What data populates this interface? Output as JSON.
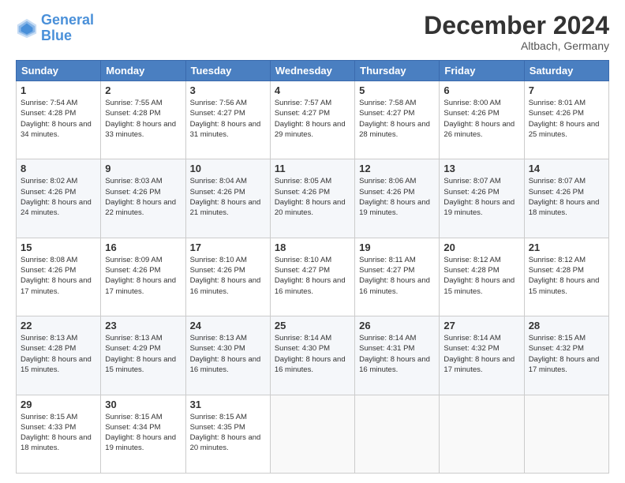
{
  "logo": {
    "line1": "General",
    "line2": "Blue"
  },
  "title": "December 2024",
  "location": "Altbach, Germany",
  "days_header": [
    "Sunday",
    "Monday",
    "Tuesday",
    "Wednesday",
    "Thursday",
    "Friday",
    "Saturday"
  ],
  "weeks": [
    [
      {
        "num": "1",
        "rise": "7:54 AM",
        "set": "4:28 PM",
        "daylight": "8 hours and 34 minutes."
      },
      {
        "num": "2",
        "rise": "7:55 AM",
        "set": "4:28 PM",
        "daylight": "8 hours and 33 minutes."
      },
      {
        "num": "3",
        "rise": "7:56 AM",
        "set": "4:27 PM",
        "daylight": "8 hours and 31 minutes."
      },
      {
        "num": "4",
        "rise": "7:57 AM",
        "set": "4:27 PM",
        "daylight": "8 hours and 29 minutes."
      },
      {
        "num": "5",
        "rise": "7:58 AM",
        "set": "4:27 PM",
        "daylight": "8 hours and 28 minutes."
      },
      {
        "num": "6",
        "rise": "8:00 AM",
        "set": "4:26 PM",
        "daylight": "8 hours and 26 minutes."
      },
      {
        "num": "7",
        "rise": "8:01 AM",
        "set": "4:26 PM",
        "daylight": "8 hours and 25 minutes."
      }
    ],
    [
      {
        "num": "8",
        "rise": "8:02 AM",
        "set": "4:26 PM",
        "daylight": "8 hours and 24 minutes."
      },
      {
        "num": "9",
        "rise": "8:03 AM",
        "set": "4:26 PM",
        "daylight": "8 hours and 22 minutes."
      },
      {
        "num": "10",
        "rise": "8:04 AM",
        "set": "4:26 PM",
        "daylight": "8 hours and 21 minutes."
      },
      {
        "num": "11",
        "rise": "8:05 AM",
        "set": "4:26 PM",
        "daylight": "8 hours and 20 minutes."
      },
      {
        "num": "12",
        "rise": "8:06 AM",
        "set": "4:26 PM",
        "daylight": "8 hours and 19 minutes."
      },
      {
        "num": "13",
        "rise": "8:07 AM",
        "set": "4:26 PM",
        "daylight": "8 hours and 19 minutes."
      },
      {
        "num": "14",
        "rise": "8:07 AM",
        "set": "4:26 PM",
        "daylight": "8 hours and 18 minutes."
      }
    ],
    [
      {
        "num": "15",
        "rise": "8:08 AM",
        "set": "4:26 PM",
        "daylight": "8 hours and 17 minutes."
      },
      {
        "num": "16",
        "rise": "8:09 AM",
        "set": "4:26 PM",
        "daylight": "8 hours and 17 minutes."
      },
      {
        "num": "17",
        "rise": "8:10 AM",
        "set": "4:26 PM",
        "daylight": "8 hours and 16 minutes."
      },
      {
        "num": "18",
        "rise": "8:10 AM",
        "set": "4:27 PM",
        "daylight": "8 hours and 16 minutes."
      },
      {
        "num": "19",
        "rise": "8:11 AM",
        "set": "4:27 PM",
        "daylight": "8 hours and 16 minutes."
      },
      {
        "num": "20",
        "rise": "8:12 AM",
        "set": "4:28 PM",
        "daylight": "8 hours and 15 minutes."
      },
      {
        "num": "21",
        "rise": "8:12 AM",
        "set": "4:28 PM",
        "daylight": "8 hours and 15 minutes."
      }
    ],
    [
      {
        "num": "22",
        "rise": "8:13 AM",
        "set": "4:28 PM",
        "daylight": "8 hours and 15 minutes."
      },
      {
        "num": "23",
        "rise": "8:13 AM",
        "set": "4:29 PM",
        "daylight": "8 hours and 15 minutes."
      },
      {
        "num": "24",
        "rise": "8:13 AM",
        "set": "4:30 PM",
        "daylight": "8 hours and 16 minutes."
      },
      {
        "num": "25",
        "rise": "8:14 AM",
        "set": "4:30 PM",
        "daylight": "8 hours and 16 minutes."
      },
      {
        "num": "26",
        "rise": "8:14 AM",
        "set": "4:31 PM",
        "daylight": "8 hours and 16 minutes."
      },
      {
        "num": "27",
        "rise": "8:14 AM",
        "set": "4:32 PM",
        "daylight": "8 hours and 17 minutes."
      },
      {
        "num": "28",
        "rise": "8:15 AM",
        "set": "4:32 PM",
        "daylight": "8 hours and 17 minutes."
      }
    ],
    [
      {
        "num": "29",
        "rise": "8:15 AM",
        "set": "4:33 PM",
        "daylight": "8 hours and 18 minutes."
      },
      {
        "num": "30",
        "rise": "8:15 AM",
        "set": "4:34 PM",
        "daylight": "8 hours and 19 minutes."
      },
      {
        "num": "31",
        "rise": "8:15 AM",
        "set": "4:35 PM",
        "daylight": "8 hours and 20 minutes."
      },
      null,
      null,
      null,
      null
    ]
  ],
  "labels": {
    "sunrise": "Sunrise:",
    "sunset": "Sunset:",
    "daylight": "Daylight:"
  }
}
